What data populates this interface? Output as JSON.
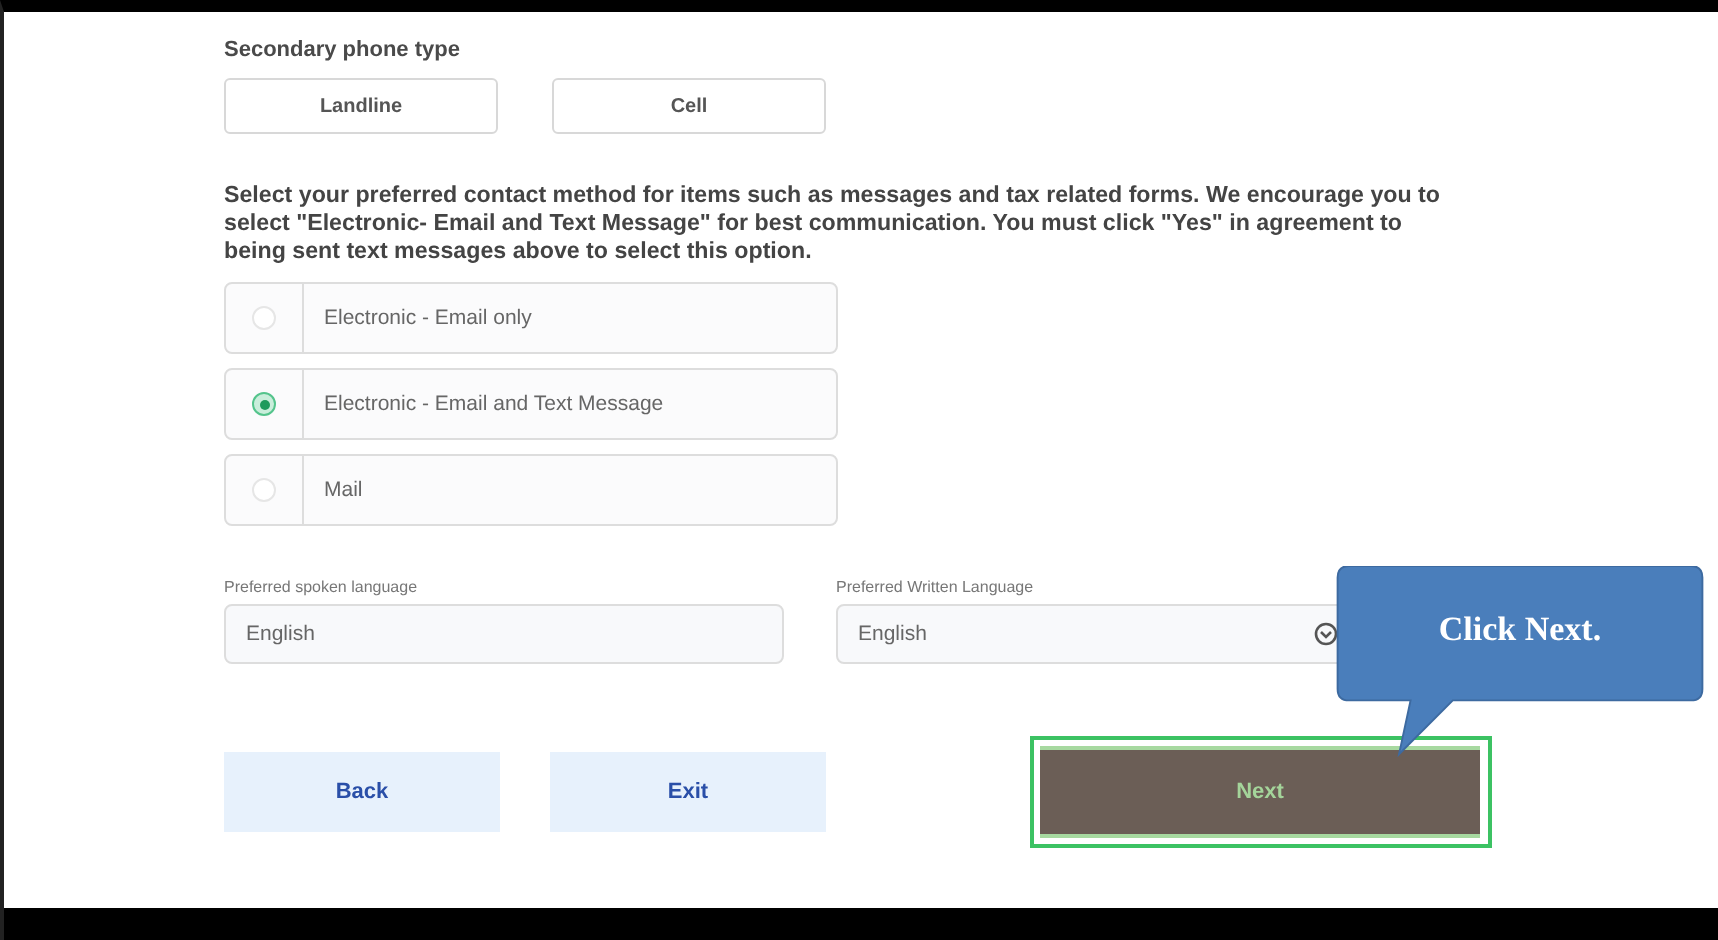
{
  "secondary_phone_type": {
    "label": "Secondary phone type",
    "options": [
      {
        "label": "Landline",
        "selected": false
      },
      {
        "label": "Cell",
        "selected": false
      }
    ]
  },
  "contact_method": {
    "prompt": "Select your preferred contact method for items such as messages and tax related forms. We encourage you to select \"Electronic- Email and Text Message\" for best communication. You must click \"Yes\" in agreement to being sent text messages above to select this option.",
    "options": [
      {
        "label": "Electronic - Email only",
        "selected": false
      },
      {
        "label": "Electronic - Email and Text Message",
        "selected": true
      },
      {
        "label": "Mail",
        "selected": false
      }
    ]
  },
  "languages": [
    {
      "label": "Preferred spoken language",
      "value": "English",
      "kind": "text"
    },
    {
      "label": "Preferred Written Language",
      "value": "English",
      "kind": "select"
    }
  ],
  "buttons": [
    {
      "label": "Back",
      "kind": "secondary"
    },
    {
      "label": "Exit",
      "kind": "secondary"
    },
    {
      "label": "Next",
      "kind": "primary",
      "highlighted": true
    }
  ],
  "callout": {
    "text": "Click Next."
  }
}
